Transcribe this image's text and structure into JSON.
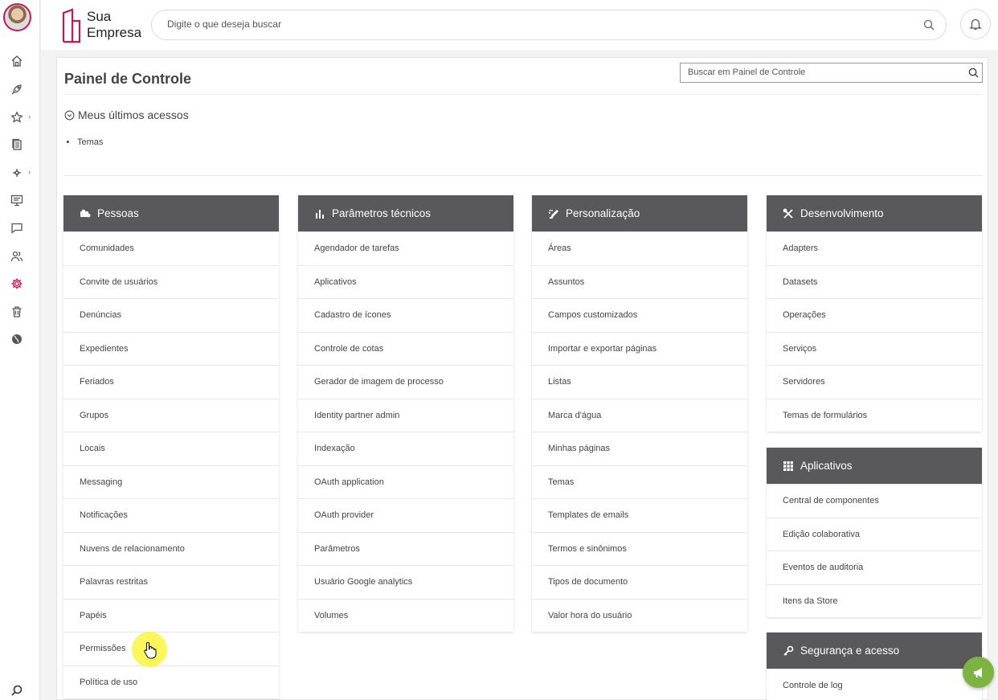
{
  "rail": {
    "icons": [
      "home-icon",
      "rocket-icon",
      "star-icon",
      "documents-icon",
      "workflow-icon",
      "monitor-icon",
      "chat-icon",
      "people-icon",
      "gear-icon",
      "trash-icon",
      "globe-icon",
      "search-bottom-icon"
    ]
  },
  "topbar": {
    "logo_line1": "Sua",
    "logo_line2": "Empresa",
    "search_placeholder": "Digite o que deseja buscar"
  },
  "page": {
    "title": "Painel de Controle",
    "search_placeholder": "Buscar em Painel de Controle",
    "recent_title": "Meus últimos acessos",
    "recent_items": [
      "Temas"
    ]
  },
  "cards": {
    "pessoas": {
      "title": "Pessoas",
      "items": [
        "Comunidades",
        "Convite de usuários",
        "Denúncias",
        "Expedientes",
        "Feriados",
        "Grupos",
        "Locais",
        "Messaging",
        "Notificações",
        "Nuvens de relacionamento",
        "Palavras restritas",
        "Papéis",
        "Permissões",
        "Política de uso"
      ]
    },
    "parametros": {
      "title": "Parâmetros técnicos",
      "items": [
        "Agendador de tarefas",
        "Aplicativos",
        "Cadastro de ícones",
        "Controle de cotas",
        "Gerador de imagem de processo",
        "Identity partner admin",
        "Indexação",
        "OAuth application",
        "OAuth provider",
        "Parâmetros",
        "Usuário Google analytics",
        "Volumes"
      ]
    },
    "personalizacao": {
      "title": "Personalização",
      "items": [
        "Áreas",
        "Assuntos",
        "Campos customizados",
        "Importar e exportar páginas",
        "Listas",
        "Marca d'água",
        "Minhas páginas",
        "Temas",
        "Templates de emails",
        "Termos e sinônimos",
        "Tipos de documento",
        "Valor hora do usuário"
      ]
    },
    "desenvolvimento": {
      "title": "Desenvolvimento",
      "items": [
        "Adapters",
        "Datasets",
        "Operações",
        "Serviços",
        "Servidores",
        "Temas de formulários"
      ]
    },
    "aplicativos": {
      "title": "Aplicativos",
      "items": [
        "Central de componentes",
        "Edição colaborativa",
        "Eventos de auditoria",
        "Itens da Store"
      ]
    },
    "seguranca": {
      "title": "Segurança e acesso",
      "items": [
        "Controle de log"
      ]
    }
  },
  "colors": {
    "accent": "#c2185b",
    "card_header": "#59595b",
    "fab": "#7cb342"
  }
}
